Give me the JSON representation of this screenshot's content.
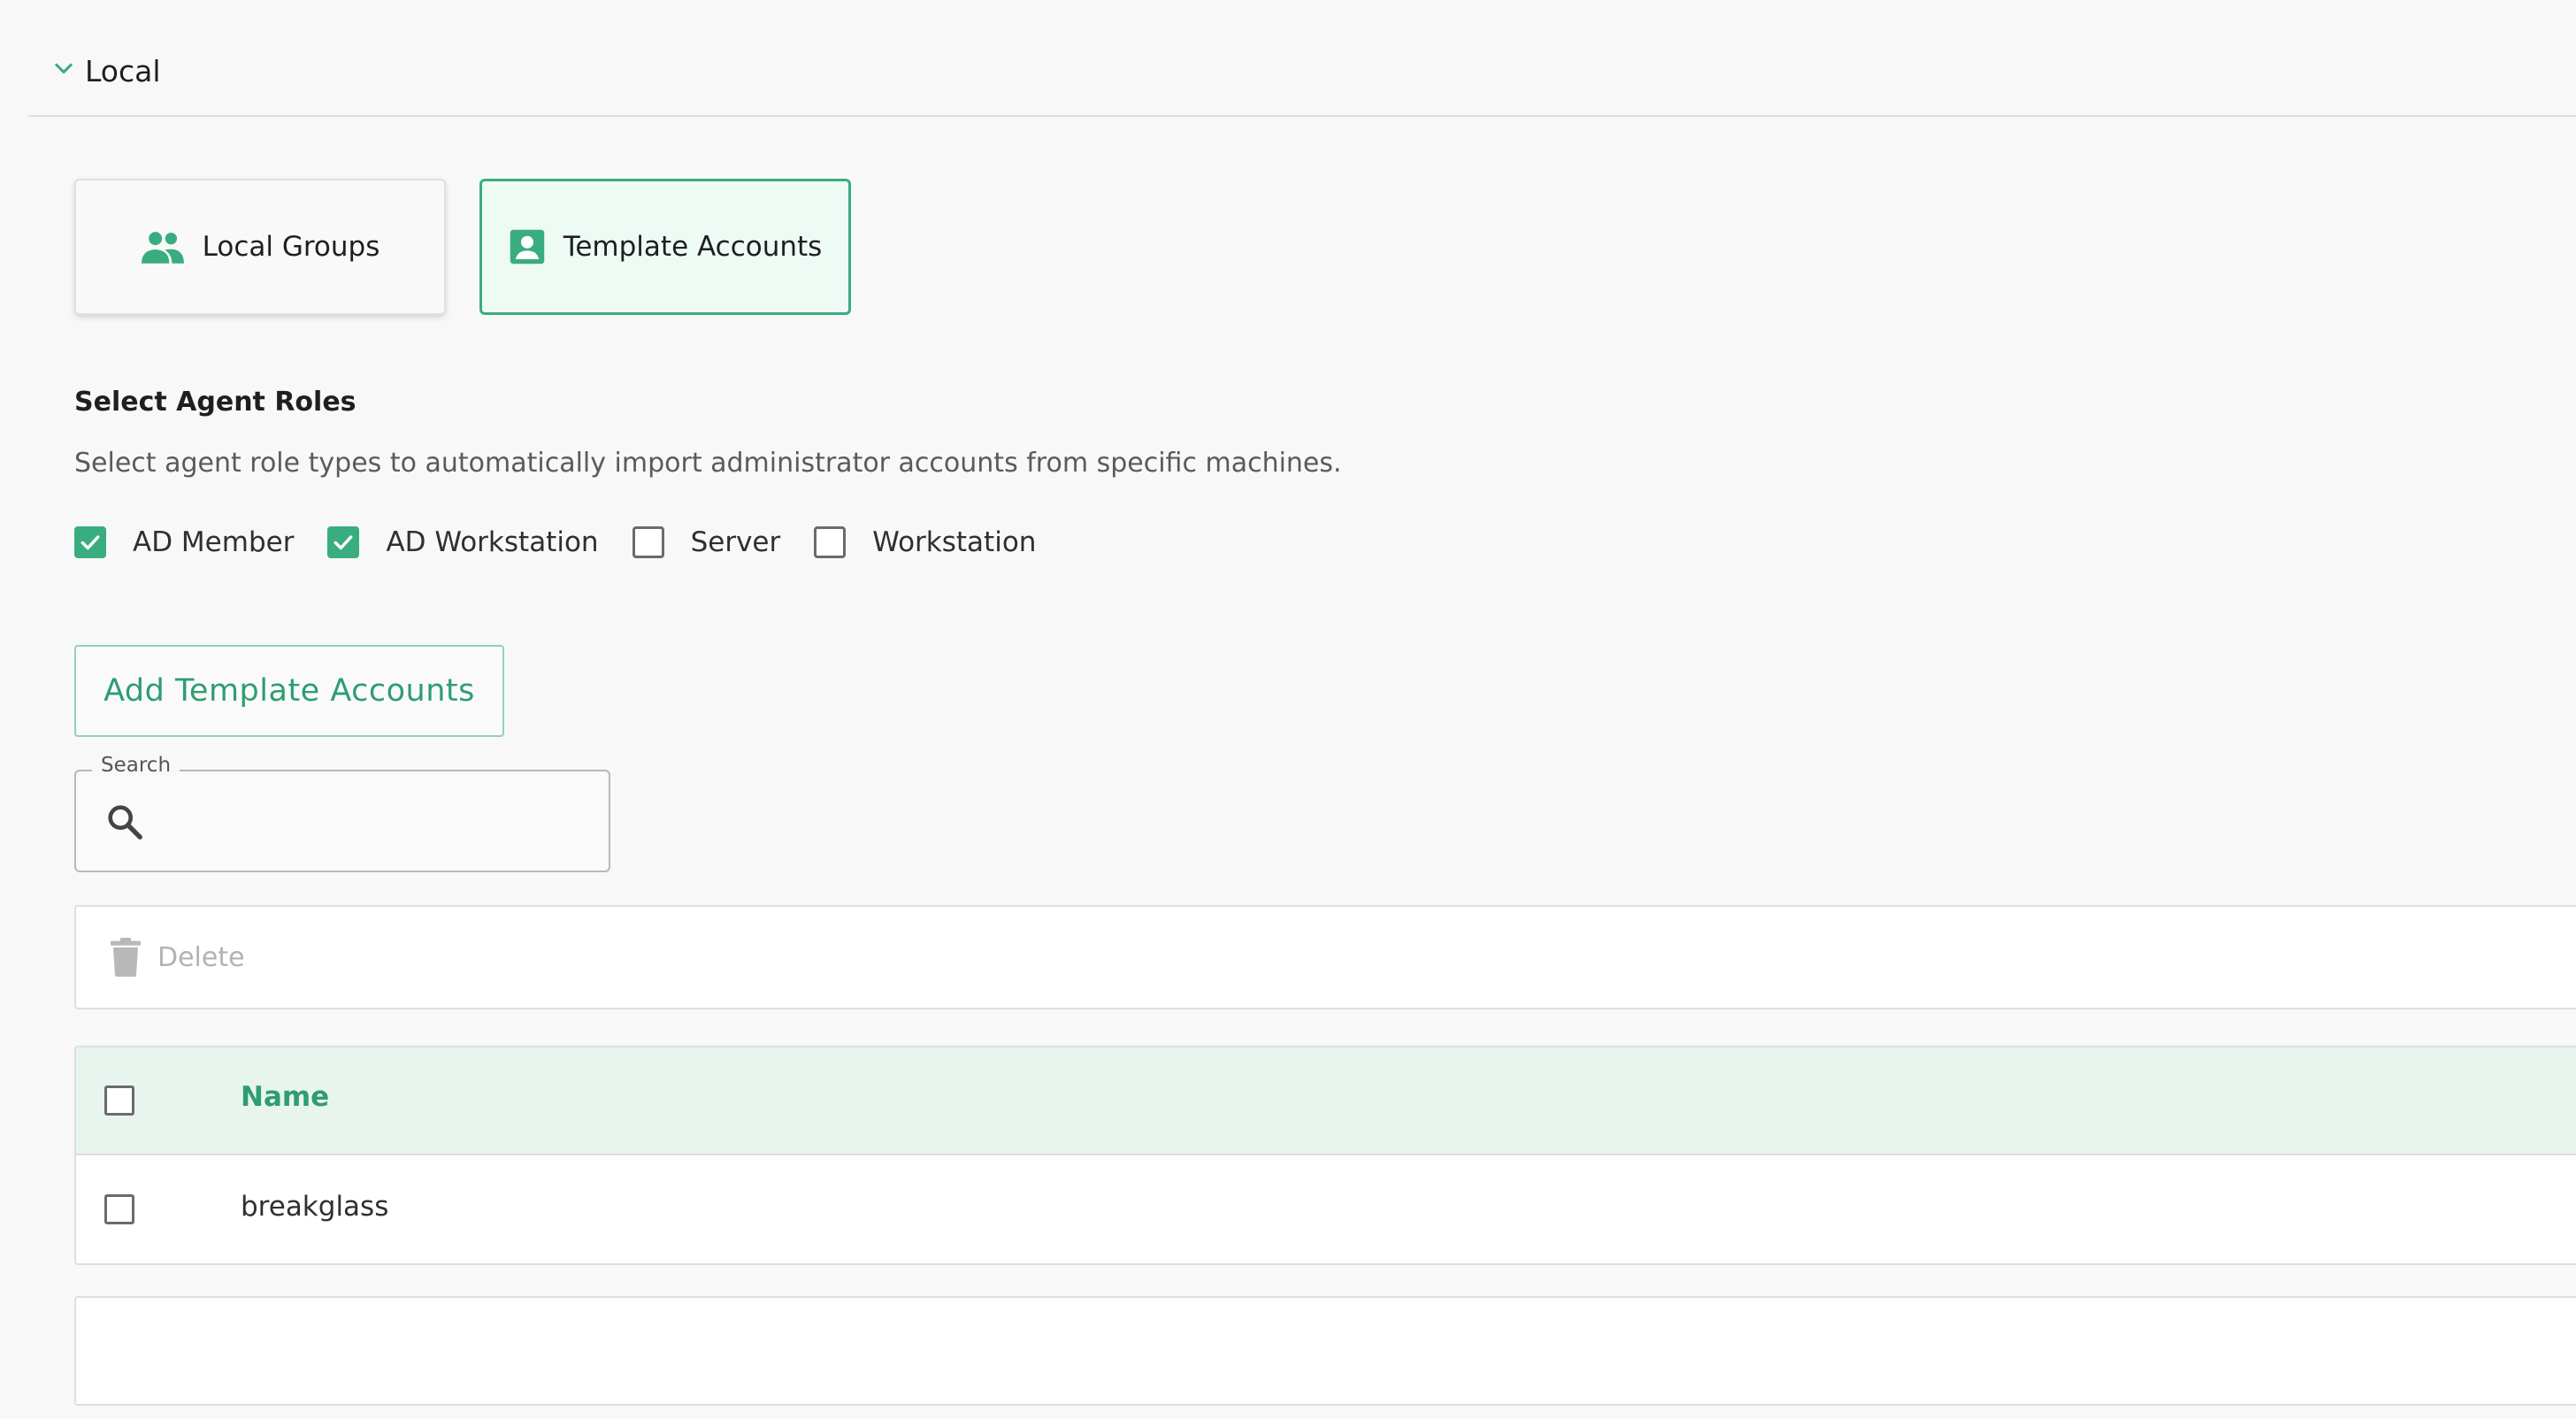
{
  "section": {
    "title": "Local"
  },
  "cards": [
    {
      "label": "Local Groups",
      "icon": "group-icon",
      "active": false
    },
    {
      "label": "Template Accounts",
      "icon": "account-box-icon",
      "active": true
    }
  ],
  "roles": {
    "title": "Select Agent Roles",
    "description": "Select agent role types to automatically import administrator accounts from specific machines.",
    "options": [
      {
        "label": "AD Member",
        "checked": true
      },
      {
        "label": "AD Workstation",
        "checked": true
      },
      {
        "label": "Server",
        "checked": false
      },
      {
        "label": "Workstation",
        "checked": false
      }
    ]
  },
  "add_button": {
    "label": "Add Template Accounts"
  },
  "search": {
    "legend": "Search",
    "value": ""
  },
  "toolbar": {
    "delete_label": "Delete"
  },
  "table": {
    "columns": [
      "Name"
    ],
    "rows": [
      {
        "name": "breakglass",
        "selected": false
      }
    ]
  },
  "colors": {
    "accent": "#3aad80",
    "accent_text": "#2f9d72",
    "header_bg": "#e8f5ef",
    "active_card_bg": "#eefbf5",
    "disabled_text": "#b3b3b3"
  }
}
